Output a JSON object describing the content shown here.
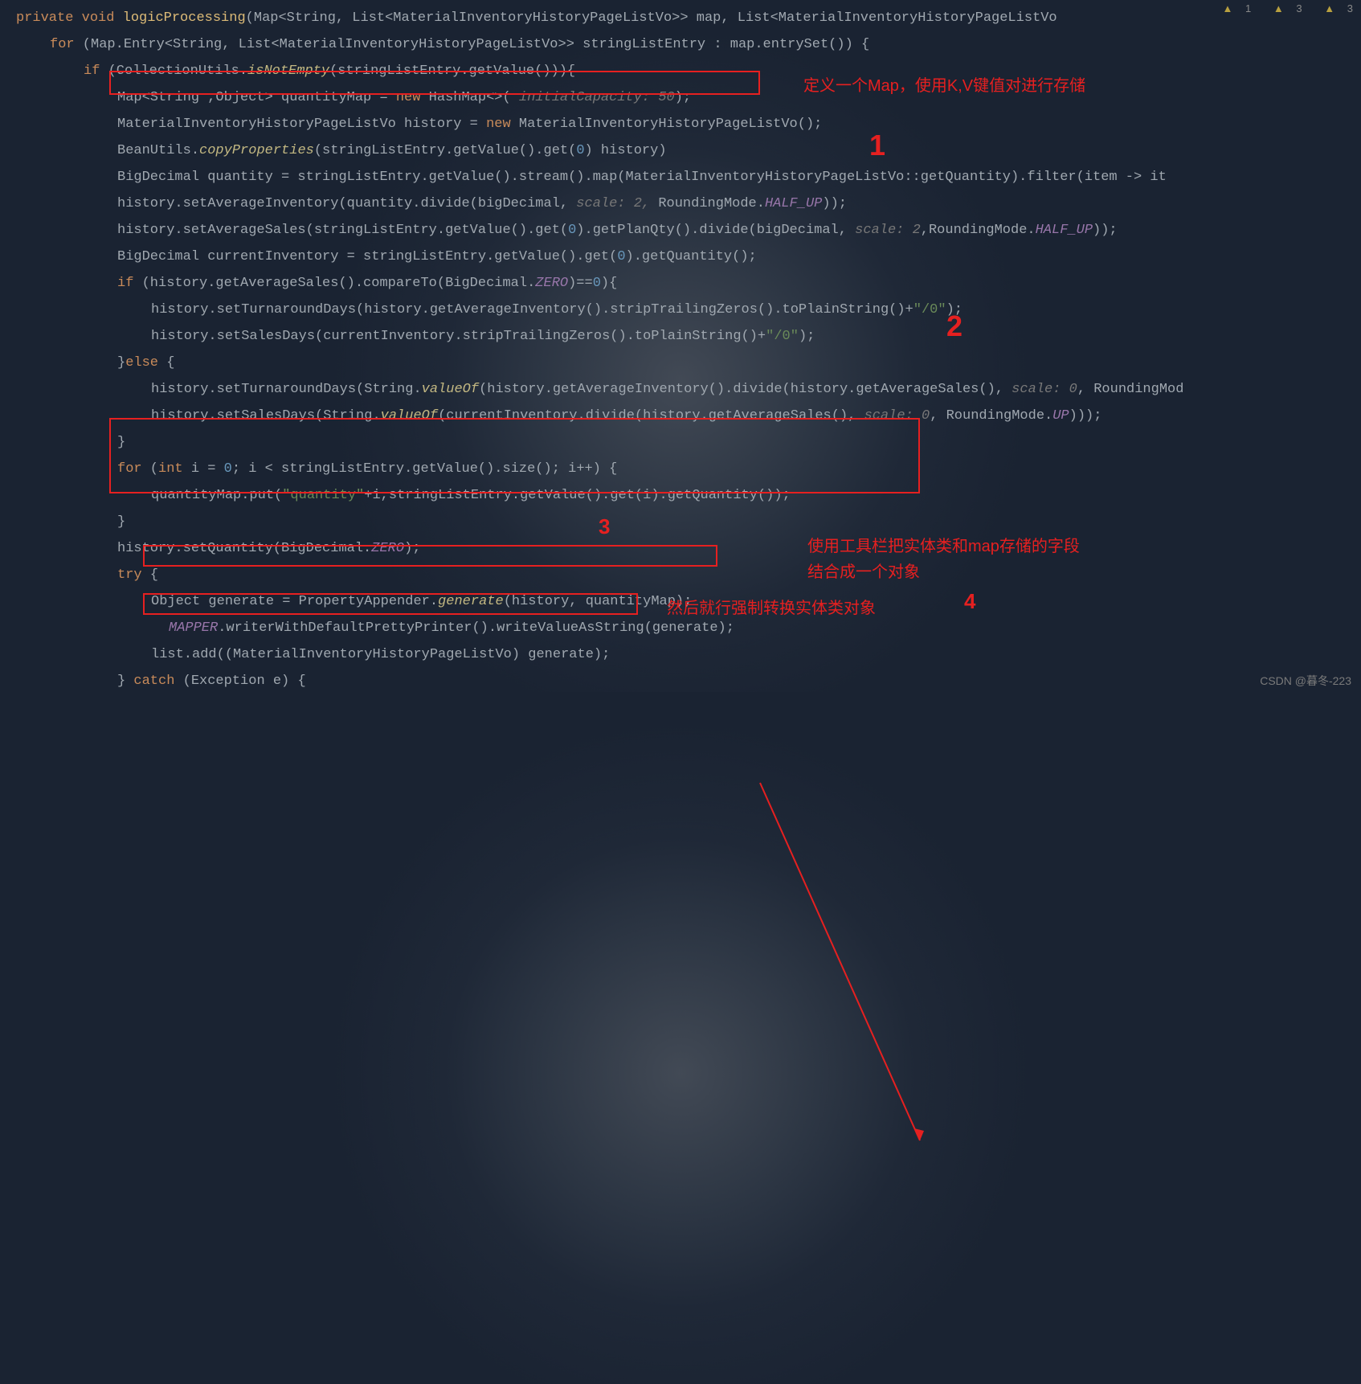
{
  "warnings": {
    "a1": "1",
    "a2": "3",
    "a3": "3"
  },
  "watermark": "CSDN @暮冬-223",
  "annotations": {
    "comment1": "定义一个Map，使用K,V键值对进行存储",
    "num1": "1",
    "num2": "2",
    "num3": "3",
    "num4": "4",
    "comment3a": "使用工具栏把实体类和map存储的字段",
    "comment3b": "结合成一个对象",
    "comment4": "然后就行强制转换实体类对象"
  },
  "code": {
    "l1": {
      "kw1": "private",
      "kw2": "void",
      "m": "logicProcessing",
      "p": "(Map<String, List<MaterialInventoryHistoryPageListVo>> map, List<MaterialInventoryHistoryPageListVo"
    },
    "l2": {
      "kw": "for",
      "p": " (Map.Entry<String, List<MaterialInventoryHistoryPageListVo>> stringListEntry : map.entrySet()) {"
    },
    "l3": {
      "kw": "if",
      "p1": " (CollectionUtils.",
      "m": "isNotEmpty",
      "p2": "(stringListEntry.getValue())){"
    },
    "l4": {
      "p1": "Map<String ,Object> quantityMap = ",
      "kw": "new",
      "p2": " HashMap<>(",
      "hint": " initialCapacity: 50",
      "p3": ");"
    },
    "l5": {
      "p1": "MaterialInventoryHistoryPageListVo history = ",
      "kw": "new",
      "p2": " MaterialInventoryHistoryPageListVo();"
    },
    "l6": {
      "p1": "BeanUtils.",
      "m": "copyProperties",
      "p2": "(stringListEntry.getValue().get(",
      "n": "0",
      "p3": ") history)"
    },
    "l7": {
      "p1": "BigDecimal quantity = stringListEntry.getValue().stream().map(MaterialInventoryHistoryPageListVo::getQuantity).filter(item -> it"
    },
    "l8": {
      "p1": "history.setAverageInventory(quantity.divide(bigDecimal,",
      "hint": " scale: 2,",
      "p2": " RoundingMode.",
      "c": "HALF_UP",
      "p3": "));"
    },
    "l9": {
      "p1": "history.setAverageSales(stringListEntry.getValue().get(",
      "n": "0",
      "p2": ").getPlanQty().divide(bigDecimal,",
      "hint": " scale: 2",
      "p3": ",RoundingMode.",
      "c": "HALF_UP",
      "p4": "));"
    },
    "l10": {
      "p1": "BigDecimal currentInventory = stringListEntry.getValue().get(",
      "n": "0",
      "p2": ").getQuantity();"
    },
    "l11": {
      "kw": "if",
      "p1": " (history.getAverageSales().compareTo(BigDecimal.",
      "c": "ZERO",
      "p2": ")==",
      "n": "0",
      "p3": "){"
    },
    "l12": {
      "p1": "history.setTurnaroundDays(history.getAverageInventory().stripTrailingZeros().toPlainString()+",
      "s": "\"/0\"",
      "p2": ");"
    },
    "l13": {
      "p1": "history.setSalesDays(currentInventory.stripTrailingZeros().toPlainString()+",
      "s": "\"/0\"",
      "p2": ");"
    },
    "l14": {
      "p1": "}",
      "kw": "else",
      "p2": " {"
    },
    "l15": {
      "p1": "history.setTurnaroundDays(String.",
      "m": "valueOf",
      "p2": "(history.getAverageInventory().divide(history.getAverageSales(),",
      "hint": " scale: 0",
      "p3": ", RoundingMod"
    },
    "l16": {
      "p1": "history.setSalesDays(String.",
      "m": "valueOf",
      "p2": "(currentInventory.divide(history.getAverageSales(),",
      "hint": " scale: 0",
      "p3": ", RoundingMode.",
      "c": "UP",
      "p4": ")));"
    },
    "l17": "}",
    "l18": {
      "kw": "for",
      "p1": " (",
      "kw2": "int",
      "p2": " i = ",
      "n1": "0",
      "p3": "; i < stringListEntry.getValue().size(); i++) {"
    },
    "l19": {
      "p1": "quantityMap.put(",
      "s": "\"quantity\"",
      "p2": "+i,stringListEntry.getValue().get(i).getQuantity());"
    },
    "l20": "}",
    "l21": {
      "p1": "history.setQuantity(BigDecimal.",
      "c": "ZERO",
      "p2": ");"
    },
    "l22": {
      "kw": "try",
      "p": " {"
    },
    "l23": {
      "p1": "Object generate = PropertyAppender.",
      "m": "generate",
      "p2": "(history, quantityMap);"
    },
    "l24": {
      "c": "MAPPER",
      "p1": ".writerWithDefaultPrettyPrinter().writeValueAsString(generate);"
    },
    "l25": {
      "p1": "list.add((MaterialInventoryHistoryPageListVo) generate);"
    },
    "l26": {
      "p1": "} ",
      "kw": "catch",
      "p2": " (Exception e) {"
    }
  }
}
